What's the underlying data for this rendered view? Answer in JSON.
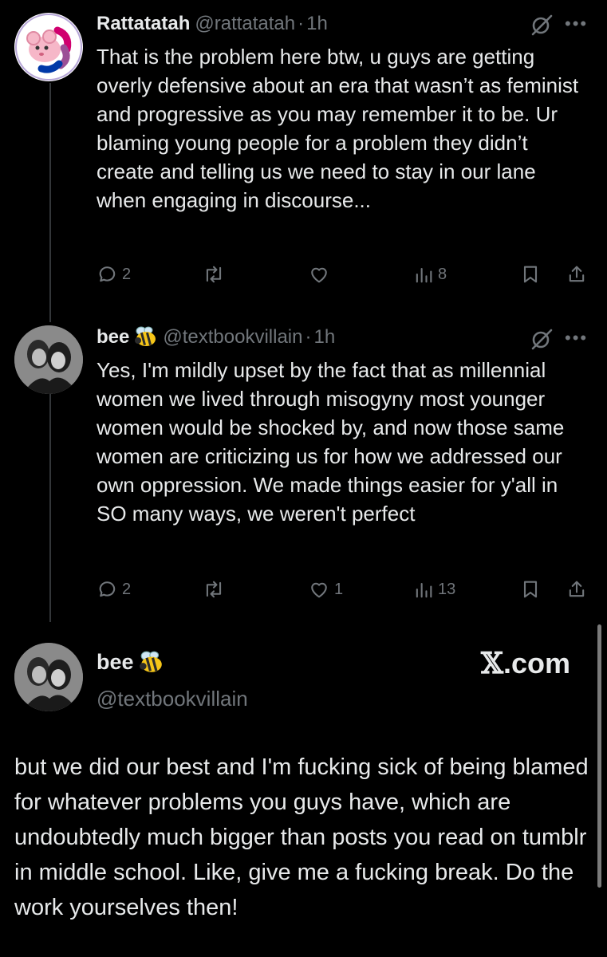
{
  "tweets": [
    {
      "name": "Rattatatah",
      "handle": "@rattatatah",
      "separator": "·",
      "time": "1h",
      "text": "That is the problem here btw, u guys are getting overly defensive about an era that wasn’t as feminist and progressive as you may remember it to be. Ur blaming young people for a problem they didn’t create and telling us we need to stay in our lane when engaging in discourse...",
      "replies": "2",
      "reposts": "",
      "likes": "",
      "views": "8"
    },
    {
      "name": "bee",
      "handle": "@textbookvillain",
      "separator": "·",
      "time": "1h",
      "text": "Yes, I'm mildly upset by the fact that as millennial women we lived through misogyny most younger women would be shocked by, and now those same women are criticizing us for how we addressed our own oppression. We made things easier for y'all in SO many ways, we weren't perfect",
      "replies": "2",
      "reposts": "",
      "likes": "1",
      "views": "13"
    }
  ],
  "main_post": {
    "name": "bee",
    "handle": "@textbookvillain",
    "watermark": ".com",
    "text": "but we did our best and I'm fucking sick of being blamed for whatever problems you guys have, which are undoubtedly much bigger than posts you read on tumblr in middle school. Like, give me a fucking break. Do the work yourselves then!"
  },
  "icons": {
    "reply": "reply-icon",
    "repost": "repost-icon",
    "like": "heart-icon",
    "views": "views-icon",
    "bookmark": "bookmark-icon",
    "share": "share-icon",
    "grok": "grok-icon",
    "more": "more-icon",
    "bee": "bee-emoji-icon"
  },
  "colors": {
    "background": "#000000",
    "text": "#e7e9ea",
    "muted": "#71767b",
    "thread_line": "#333639"
  }
}
